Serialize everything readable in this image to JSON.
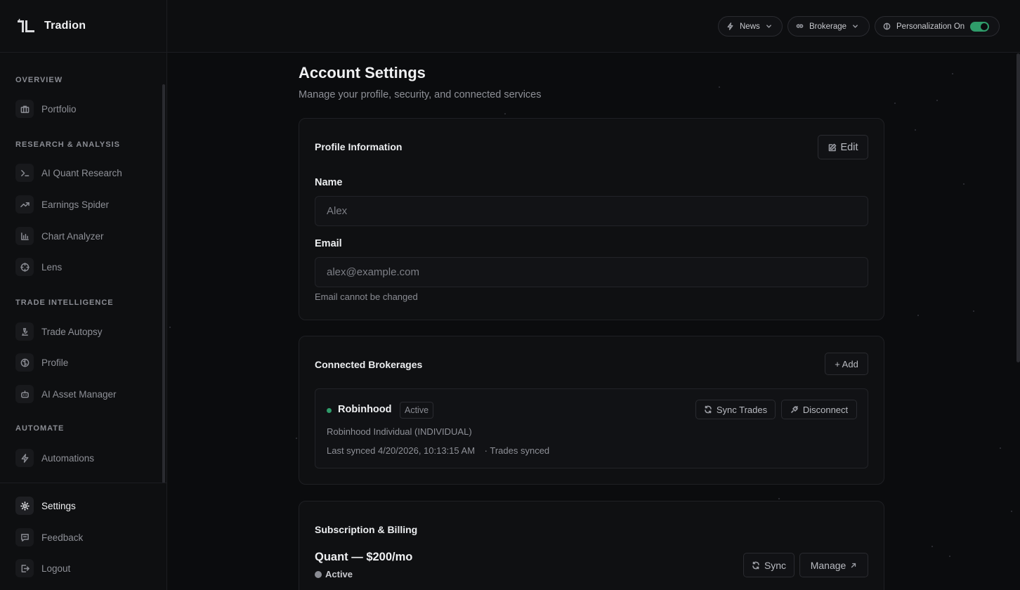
{
  "brand": {
    "name": "Tradion"
  },
  "sidebar": {
    "sections": {
      "overview": "OVERVIEW",
      "research": "RESEARCH & ANALYSIS",
      "trade": "TRADE INTELLIGENCE",
      "automate": "AUTOMATE"
    },
    "items": {
      "portfolio": "Portfolio",
      "quant": "AI Quant Research",
      "earnings": "Earnings Spider",
      "chart": "Chart Analyzer",
      "lens": "Lens",
      "autopsy": "Trade Autopsy",
      "profile": "Profile",
      "asset": "AI Asset Manager",
      "automations": "Automations",
      "settings": "Settings",
      "feedback": "Feedback",
      "logout": "Logout"
    }
  },
  "topbar": {
    "news": "News",
    "brokerage": "Brokerage",
    "personalization": "Personalization On"
  },
  "page": {
    "title": "Account Settings",
    "subtitle": "Manage your profile, security, and connected services"
  },
  "profile": {
    "title": "Profile Information",
    "edit": "Edit",
    "name_label": "Name",
    "name_value": "Alex",
    "email_label": "Email",
    "email_value": "alex@example.com",
    "email_hint": "Email cannot be changed"
  },
  "brokerages": {
    "title": "Connected Brokerages",
    "add": "+ Add",
    "item": {
      "name": "Robinhood",
      "status": "Active",
      "account": "Robinhood Individual (INDIVIDUAL)",
      "last_synced": "Last synced 4/20/2026, 10:13:15 AM",
      "trades": "· Trades synced",
      "sync": "Sync Trades",
      "disconnect": "Disconnect"
    }
  },
  "billing": {
    "title": "Subscription & Billing",
    "plan": "Quant — $200/mo",
    "status": "Active",
    "sync": "Sync",
    "manage": "Manage"
  }
}
